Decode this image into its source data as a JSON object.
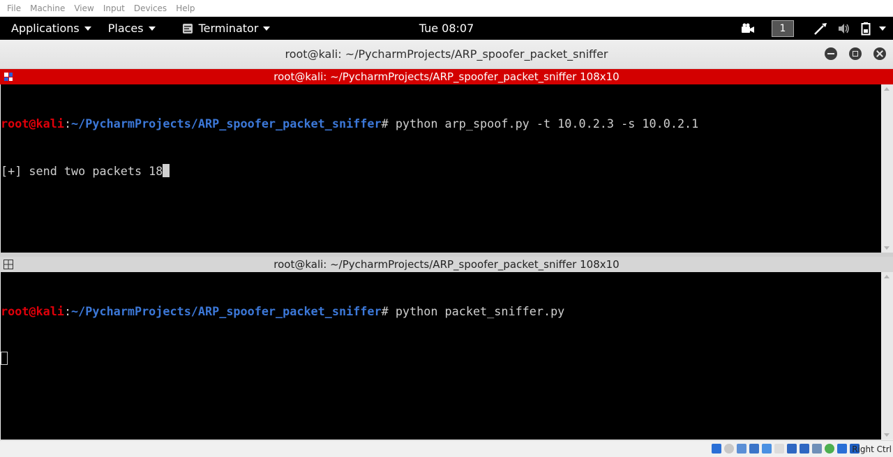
{
  "vbox_menu": [
    "File",
    "Machine",
    "View",
    "Input",
    "Devices",
    "Help"
  ],
  "topbar": {
    "applications": "Applications",
    "places": "Places",
    "app_name": "Terminator",
    "clock": "Tue 08:07",
    "workspace": "1"
  },
  "window": {
    "title": "root@kali: ~/PycharmProjects/ARP_spoofer_packet_sniffer"
  },
  "panes": [
    {
      "title": "root@kali: ~/PycharmProjects/ARP_spoofer_packet_sniffer 108x10",
      "prompt_user": "root@kali",
      "prompt_sep": ":",
      "prompt_path": "~/PycharmProjects/ARP_spoofer_packet_sniffer",
      "prompt_symbol": "# ",
      "command": "python arp_spoof.py -t 10.0.2.3 -s 10.0.2.1",
      "output": "[+] send two packets 18"
    },
    {
      "title": "root@kali: ~/PycharmProjects/ARP_spoofer_packet_sniffer 108x10",
      "prompt_user": "root@kali",
      "prompt_sep": ":",
      "prompt_path": "~/PycharmProjects/ARP_spoofer_packet_sniffer",
      "prompt_symbol": "# ",
      "command": "python packet_sniffer.py"
    }
  ],
  "statusbar": {
    "host_key": "Right Ctrl",
    "icons": [
      "hard-disk-icon",
      "optical-drive-icon",
      "audio-icon",
      "network-icon",
      "usb-icon",
      "shared-folders-icon",
      "display-icon",
      "recording-icon",
      "mouse-integration-icon",
      "virtualization-icon",
      "cpu-icon",
      "arrow-down-icon"
    ]
  },
  "colors": {
    "active_pane_bar": "#d30000",
    "prompt_user": "#e0000a",
    "prompt_path": "#3c78d8"
  }
}
